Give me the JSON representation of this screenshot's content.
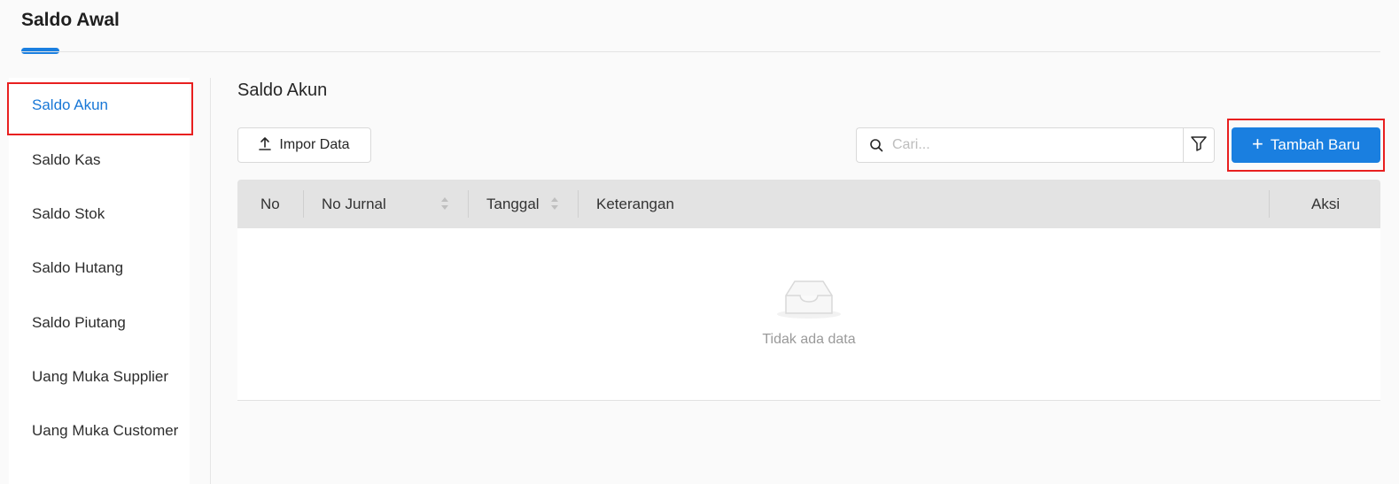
{
  "header": {
    "title": "Saldo Awal"
  },
  "sidebar": {
    "items": [
      {
        "label": "Saldo Akun",
        "active": true
      },
      {
        "label": "Saldo Kas",
        "active": false
      },
      {
        "label": "Saldo Stok",
        "active": false
      },
      {
        "label": "Saldo Hutang",
        "active": false
      },
      {
        "label": "Saldo Piutang",
        "active": false
      },
      {
        "label": "Uang Muka Supplier",
        "active": false
      },
      {
        "label": "Uang Muka Customer",
        "active": false
      }
    ]
  },
  "main": {
    "title": "Saldo Akun",
    "import_label": "Impor Data",
    "search": {
      "placeholder": "Cari...",
      "value": ""
    },
    "add_label": "Tambah Baru",
    "table": {
      "columns": [
        "No",
        "No Jurnal",
        "Tanggal",
        "Keterangan",
        "Aksi"
      ],
      "rows": [],
      "empty_text": "Tidak ada data"
    }
  },
  "icons": {
    "upload": "upload-icon",
    "search": "search-icon",
    "filter": "filter-icon",
    "plus": "plus-icon",
    "sort": "sort-icon",
    "empty": "empty-inbox-icon"
  },
  "colors": {
    "accent": "#1a7fe0",
    "active_text": "#1877d6",
    "highlight_border": "#e81f1f",
    "table_header": "#e3e3e3"
  }
}
